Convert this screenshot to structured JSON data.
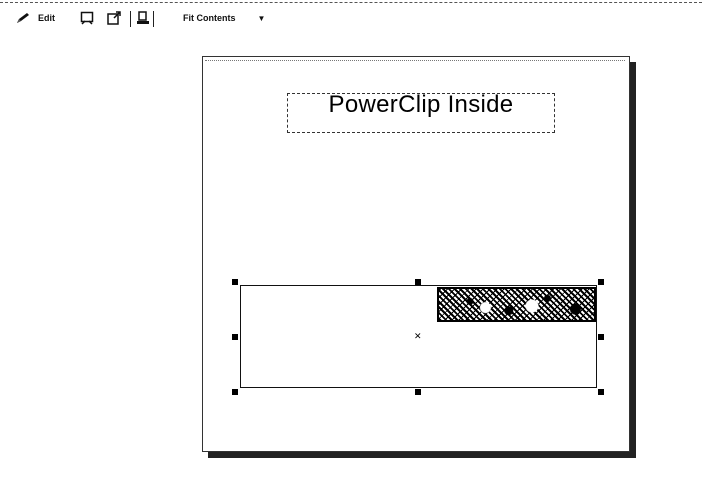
{
  "toolbar": {
    "edit_label": "Edit",
    "fit_label": "Fit Contents",
    "icons": {
      "edit": "pencil-icon",
      "select_contents": "select-contents-icon",
      "extract_contents": "extract-contents-icon",
      "lock_contents": "lock-contents-icon",
      "dropdown": "chevron-down-icon"
    }
  },
  "canvas": {
    "title_text": "PowerClip Inside"
  }
}
